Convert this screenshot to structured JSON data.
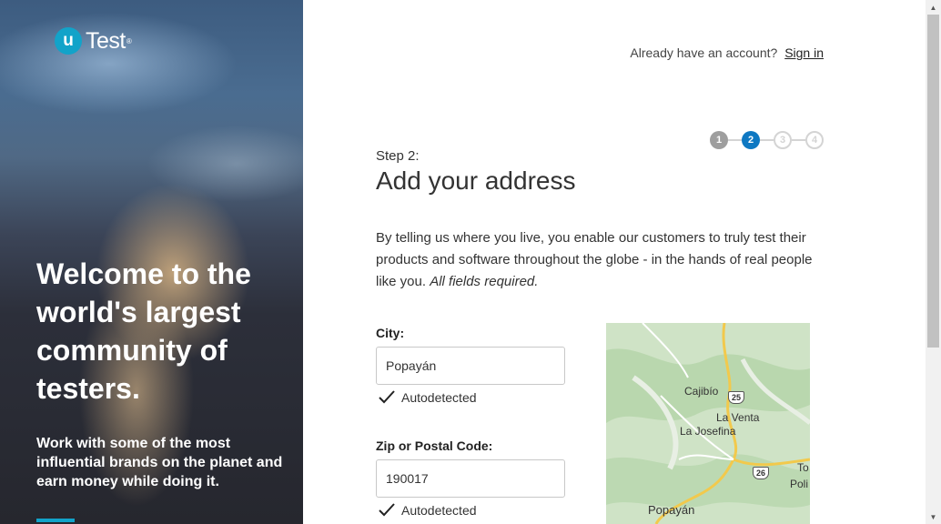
{
  "brand": {
    "logo_letter": "u",
    "logo_text": "Test",
    "logo_reg": "®",
    "accent": "#12a3c9"
  },
  "hero": {
    "heading": "Welcome to the world's largest community of testers.",
    "subheading": "Work with some of the most influential brands on the planet and earn money while doing it."
  },
  "header": {
    "account_prompt": "Already have an account?",
    "signin_label": "Sign in"
  },
  "stepper": {
    "steps": [
      {
        "label": "1",
        "state": "done"
      },
      {
        "label": "2",
        "state": "active"
      },
      {
        "label": "3",
        "state": "pending"
      },
      {
        "label": "4",
        "state": "pending"
      }
    ],
    "active_color": "#0e78c2"
  },
  "form": {
    "step_label": "Step 2:",
    "title": "Add your address",
    "intro": "By telling us where you live, you enable our customers to truly test their products and software throughout the globe - in the hands of real people like you.",
    "intro_emphasis": "All fields required.",
    "city": {
      "label": "City:",
      "value": "Popayán",
      "status": "Autodetected"
    },
    "zip": {
      "label": "Zip or Postal Code:",
      "value": "190017",
      "status": "Autodetected"
    }
  },
  "map": {
    "places": [
      "Cajibío",
      "La Venta",
      "La Josefina",
      "Popayán",
      "To",
      "Poli"
    ],
    "shields": [
      "25",
      "26"
    ]
  },
  "icons": {
    "check": "check-icon",
    "scroll_up": "▲",
    "scroll_down": "▼"
  }
}
